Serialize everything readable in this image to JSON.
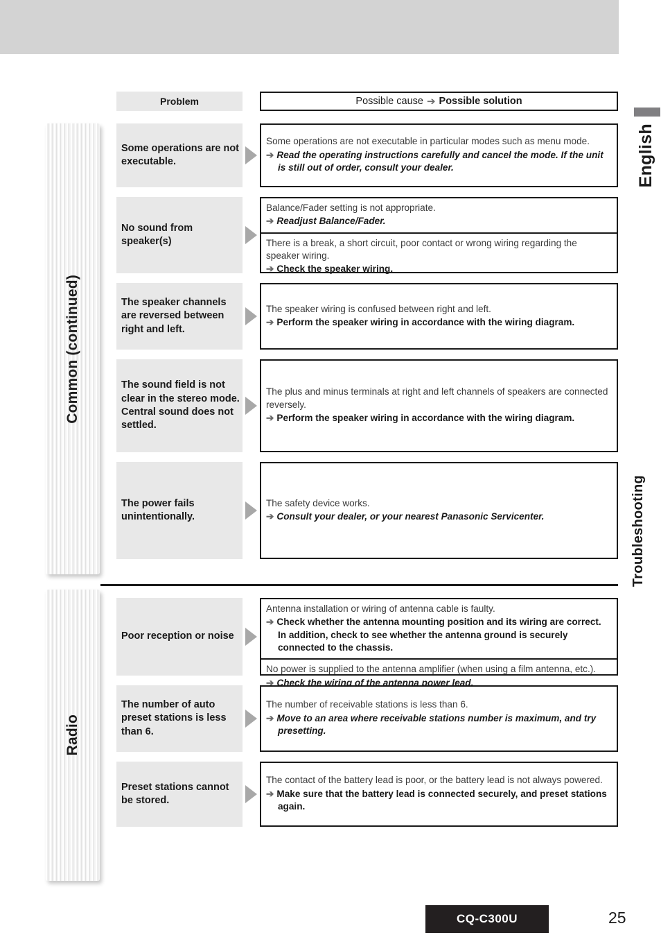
{
  "page": {
    "language_label": "English",
    "section_label": "Troubleshooting",
    "model_badge": "CQ-C300U",
    "page_number": "25",
    "colors": {
      "top_band": "#d3d3d3",
      "problem_cell": "#e8e8e8",
      "arrow_gray": "#6b6b6b",
      "triangle_gray": "#a8a8a8",
      "badge_black": "#231f20",
      "rail_tab_gray": "#807f82"
    }
  },
  "table": {
    "header": {
      "problem": "Problem",
      "cause_prefix": "Possible cause",
      "cause_arrow": "➔",
      "cause_suffix": "Possible solution"
    }
  },
  "sections": [
    {
      "tab_label": "Common (continued)",
      "rows": [
        {
          "problem": "Some operations are not executable.",
          "causes": [
            {
              "cause": "Some operations are not executable in particular modes such as menu mode.",
              "arrow": "➔",
              "solution": "Read the operating instructions carefully and cancel the mode. If the unit is still out of order, consult your dealer.",
              "solution_style": "bold-italic"
            }
          ]
        },
        {
          "problem": "No sound from speaker(s)",
          "causes": [
            {
              "cause": "Balance/Fader setting is not appropriate.",
              "arrow": "➔",
              "solution": "Readjust Balance/Fader.",
              "solution_style": "bold-italic"
            },
            {
              "cause": "There is a break, a short circuit, poor contact or wrong wiring regarding the speaker wiring.",
              "arrow": "➔",
              "solution": "Check the speaker wiring.",
              "solution_style": "bold"
            }
          ]
        },
        {
          "problem": "The speaker channels are reversed between right and left.",
          "causes": [
            {
              "cause": "The speaker wiring is confused between right and left.",
              "arrow": "➔",
              "solution": "Perform the speaker wiring in accordance with the wiring diagram.",
              "solution_style": "bold"
            }
          ]
        },
        {
          "problem": "The sound field is not clear in the stereo mode.\nCentral sound does not settled.",
          "causes": [
            {
              "cause": "The plus and minus terminals at right and left channels of speakers are connected reversely.",
              "arrow": "➔",
              "solution": "Perform the speaker wiring in accordance with the wiring diagram.",
              "solution_style": "bold"
            }
          ]
        },
        {
          "problem": "The power fails unintentionally.",
          "causes": [
            {
              "cause": "The safety device works.",
              "arrow": "➔",
              "solution": "Consult your dealer, or your nearest Panasonic Servicenter.",
              "solution_style": "bold-italic"
            }
          ]
        }
      ]
    },
    {
      "tab_label": "Radio",
      "rows": [
        {
          "problem": "Poor reception or noise",
          "causes": [
            {
              "cause": "Antenna installation or wiring of antenna cable is faulty.",
              "arrow": "➔",
              "solution": "Check whether the antenna mounting position and its wiring are correct. In addition, check to see whether the antenna ground is securely connected to the chassis.",
              "solution_style": "bold"
            },
            {
              "cause": "No power is supplied to the antenna amplifier (when using a film antenna, etc.).",
              "arrow": "➔",
              "solution": "Check the wiring of the antenna power lead.",
              "solution_style": "bold-italic"
            }
          ]
        },
        {
          "problem": "The number of auto preset stations is less than 6.",
          "causes": [
            {
              "cause": "The number of receivable stations is less than 6.",
              "arrow": "➔",
              "solution": "Move to an area where receivable stations number is maximum, and try presetting.",
              "solution_style": "bold-italic"
            }
          ]
        },
        {
          "problem": "Preset stations cannot be stored.",
          "causes": [
            {
              "cause": "The contact of the battery lead is poor, or the battery lead is not always powered.",
              "arrow": "➔",
              "solution": "Make sure that the battery lead is connected securely, and preset stations again.",
              "solution_style": "bold"
            }
          ]
        }
      ]
    }
  ]
}
